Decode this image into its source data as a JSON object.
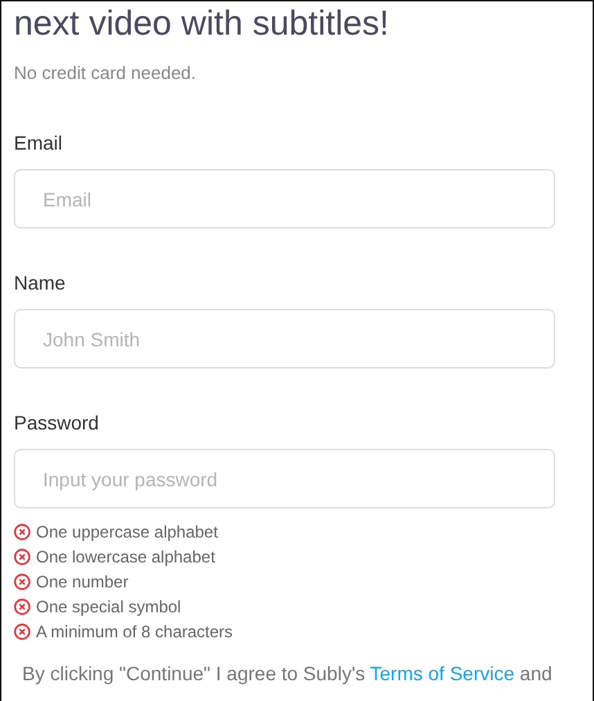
{
  "heading": "next video with subtitles!",
  "subheading": "No credit card needed.",
  "fields": [
    {
      "label": "Email",
      "placeholder": "Email"
    },
    {
      "label": "Name",
      "placeholder": "John Smith"
    },
    {
      "label": "Password",
      "placeholder": "Input your password"
    }
  ],
  "password_rules": [
    {
      "text": "One uppercase alphabet",
      "met": false
    },
    {
      "text": "One lowercase alphabet",
      "met": false
    },
    {
      "text": "One number",
      "met": false
    },
    {
      "text": "One special symbol",
      "met": false
    },
    {
      "text": "A minimum of 8 characters",
      "met": false
    }
  ],
  "consent": {
    "before": "By clicking \"Continue\" I agree to Subly's ",
    "link": "Terms of Service",
    "after": " and"
  }
}
